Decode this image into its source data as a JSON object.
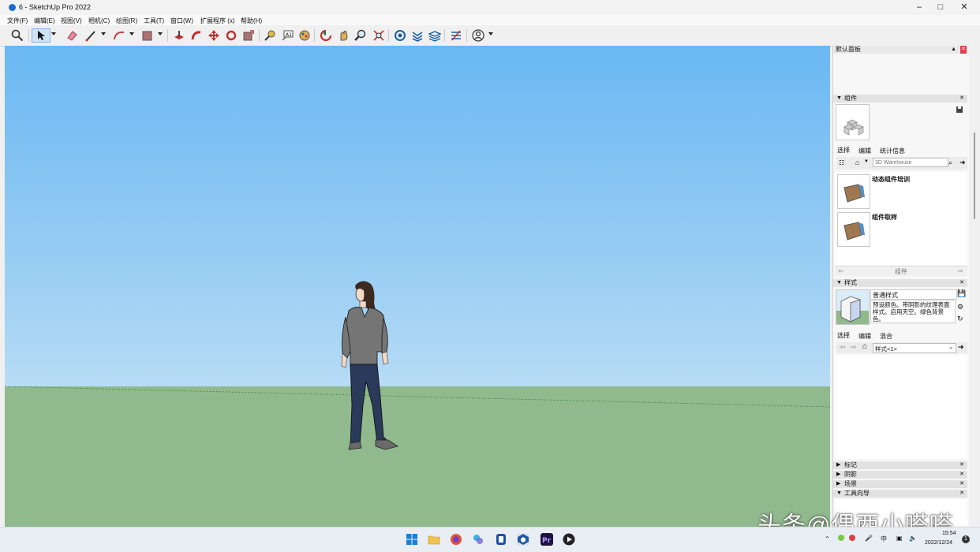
{
  "window": {
    "title": "6 - SketchUp Pro 2022",
    "controls": [
      "minimize-icon",
      "maximize-icon",
      "close-icon"
    ]
  },
  "menu": [
    "文件(F)",
    "编辑(E)",
    "视图(V)",
    "相机(C)",
    "绘图(R)",
    "工具(T)",
    "窗口(W)",
    "扩展程序 (x)",
    "帮助(H)"
  ],
  "toolbar": {
    "active_tool": "select-tool",
    "tools": [
      "search-icon",
      "select-tool",
      "eraser-tool",
      "line-tool",
      "arc-tool",
      "shape-tool",
      "push-pull-tool",
      "follow-me-tool",
      "move-tool",
      "rotate-tool",
      "scale-tool",
      "tape-measure-tool",
      "text-tool",
      "paint-bucket-tool",
      "orbit-tool",
      "pan-tool",
      "zoom-tool",
      "zoom-extents-tool",
      "warehouse-icon",
      "extension-warehouse-icon",
      "layout-icon",
      "sandbox-icon",
      "account-icon"
    ]
  },
  "panel": {
    "title": "默认面板",
    "components": {
      "header": "组件",
      "tabs": [
        "选择",
        "编辑",
        "统计信息"
      ],
      "search_placeholder": "3D Warehouse",
      "items": [
        {
          "name": "动态组件培训"
        },
        {
          "name": "组件取样"
        }
      ],
      "footer_label": "组件"
    },
    "styles": {
      "header": "样式",
      "style_name": "普通样式",
      "style_description": "预设颜色。带阴影的纹理表面样式。启用天空。绿色背景色。",
      "tabs": [
        "选择",
        "编辑",
        "混合"
      ],
      "dropdown_value": "样式<1>"
    },
    "collapsed_sections": [
      "标记",
      "阴影",
      "场景"
    ],
    "expanded_section": "工具向导"
  },
  "watermark": "头条@偶西小嗒嗒",
  "taskbar": {
    "apps": [
      "windows-start-icon",
      "file-explorer-icon",
      "firefox-icon",
      "app-icon",
      "store-icon",
      "sketchup-icon",
      "premiere-icon",
      "media-player-icon"
    ],
    "lang": "中",
    "time": "15:54",
    "date": "2022/12/24",
    "notifications": "1"
  },
  "colors": {
    "sky_top": "#6ab8f3",
    "sky_bottom": "#d9ecf8",
    "ground": "#91b98e",
    "accent": "#1a6fc9"
  }
}
